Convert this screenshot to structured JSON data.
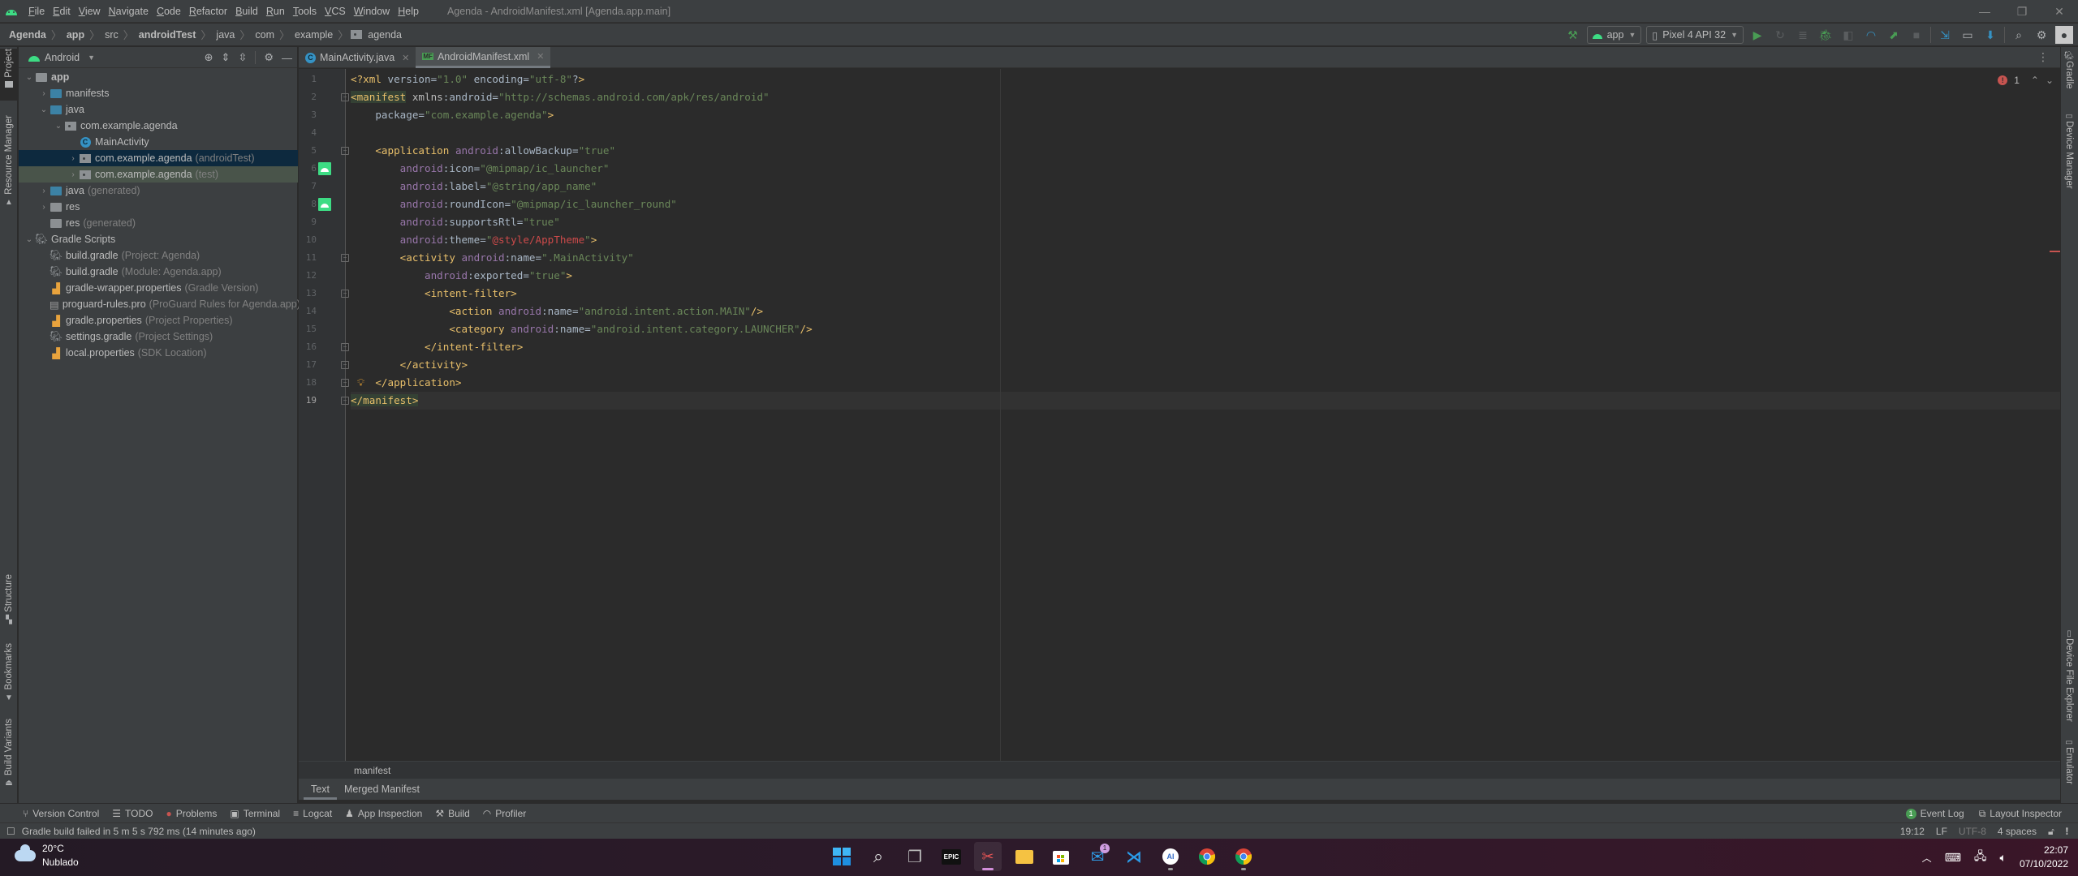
{
  "titlebar": {
    "menu": [
      "File",
      "Edit",
      "View",
      "Navigate",
      "Code",
      "Refactor",
      "Build",
      "Run",
      "Tools",
      "VCS",
      "Window",
      "Help"
    ],
    "window_title": "Agenda - AndroidManifest.xml [Agenda.app.main]"
  },
  "navbar": {
    "breadcrumbs": [
      "Agenda",
      "app",
      "src",
      "androidTest",
      "java",
      "com",
      "example",
      "agenda"
    ],
    "run_config": "app",
    "device": "Pixel 4 API 32"
  },
  "left_stripe": {
    "tabs": [
      "Project",
      "Resource Manager",
      "Structure",
      "Bookmarks",
      "Build Variants"
    ]
  },
  "right_stripe": {
    "tabs": [
      "Gradle",
      "Device Manager",
      "Device File Explorer",
      "Emulator"
    ]
  },
  "project": {
    "view_mode": "Android",
    "tree": [
      {
        "label": "app",
        "hint": "",
        "expanded": "open"
      },
      {
        "label": "manifests",
        "hint": "",
        "expanded": "closed"
      },
      {
        "label": "java",
        "hint": "",
        "expanded": "open"
      },
      {
        "label": "com.example.agenda",
        "hint": "",
        "expanded": "open"
      },
      {
        "label": "MainActivity",
        "hint": "",
        "expanded": "none"
      },
      {
        "label": "com.example.agenda",
        "hint": "(androidTest)",
        "expanded": "closed"
      },
      {
        "label": "com.example.agenda",
        "hint": "(test)",
        "expanded": "closed"
      },
      {
        "label": "java",
        "hint": "(generated)",
        "expanded": "closed"
      },
      {
        "label": "res",
        "hint": "",
        "expanded": "closed"
      },
      {
        "label": "res",
        "hint": "(generated)",
        "expanded": "none"
      },
      {
        "label": "Gradle Scripts",
        "hint": "",
        "expanded": "open"
      },
      {
        "label": "build.gradle",
        "hint": "(Project: Agenda)",
        "expanded": "none"
      },
      {
        "label": "build.gradle",
        "hint": "(Module: Agenda.app)",
        "expanded": "none"
      },
      {
        "label": "gradle-wrapper.properties",
        "hint": "(Gradle Version)",
        "expanded": "none"
      },
      {
        "label": "proguard-rules.pro",
        "hint": "(ProGuard Rules for Agenda.app)",
        "expanded": "none"
      },
      {
        "label": "gradle.properties",
        "hint": "(Project Properties)",
        "expanded": "none"
      },
      {
        "label": "settings.gradle",
        "hint": "(Project Settings)",
        "expanded": "none"
      },
      {
        "label": "local.properties",
        "hint": "(SDK Location)",
        "expanded": "none"
      }
    ]
  },
  "editor": {
    "tabs": [
      {
        "label": "MainActivity.java",
        "active": false
      },
      {
        "label": "AndroidManifest.xml",
        "active": true
      }
    ],
    "error_count": "1",
    "line_numbers": [
      "1",
      "2",
      "3",
      "4",
      "5",
      "6",
      "7",
      "8",
      "9",
      "10",
      "11",
      "12",
      "13",
      "14",
      "15",
      "16",
      "17",
      "18",
      "19"
    ],
    "lines": [
      "<?xml version=\"1.0\" encoding=\"utf-8\"?>",
      "<manifest xmlns:android=\"http://schemas.android.com/apk/res/android\"",
      "    package=\"com.example.agenda\">",
      "",
      "    <application android:allowBackup=\"true\"",
      "        android:icon=\"@mipmap/ic_launcher\"",
      "        android:label=\"@string/app_name\"",
      "        android:roundIcon=\"@mipmap/ic_launcher_round\"",
      "        android:supportsRtl=\"true\"",
      "        android:theme=\"@style/AppTheme\">",
      "        <activity android:name=\".MainActivity\"",
      "            android:exported=\"true\">",
      "            <intent-filter>",
      "                <action android:name=\"android.intent.action.MAIN\"/>",
      "                <category android:name=\"android.intent.category.LAUNCHER\"/>",
      "            </intent-filter>",
      "        </activity>",
      "    </application>",
      "</manifest>"
    ],
    "xml_breadcrumb": "manifest",
    "bottom_tabs": [
      "Text",
      "Merged Manifest"
    ]
  },
  "toolwindows": {
    "left": [
      "Version Control",
      "TODO",
      "Problems",
      "Terminal",
      "Logcat",
      "App Inspection",
      "Build",
      "Profiler"
    ],
    "event_log": "Event Log",
    "event_log_badge": "1",
    "layout_inspector": "Layout Inspector"
  },
  "statusbar": {
    "message": "Gradle build failed in 5 m 5 s 792 ms (14 minutes ago)",
    "position": "19:12",
    "line_sep": "LF",
    "encoding": "UTF-8",
    "indent": "4 spaces"
  },
  "taskbar": {
    "weather_temp": "20°C",
    "weather_desc": "Nublado",
    "mail_badge": "1",
    "time": "22:07",
    "date": "07/10/2022",
    "apps": [
      "start",
      "search",
      "task-view",
      "epic-games",
      "snipping-tool",
      "file-explorer",
      "microsoft-store",
      "mail",
      "vscode",
      "android-studio",
      "chrome",
      "chrome-profile"
    ]
  },
  "colors": {
    "accent_green": "#3ddc84",
    "error_red": "#c75450",
    "selection_blue": "#0d293e"
  }
}
